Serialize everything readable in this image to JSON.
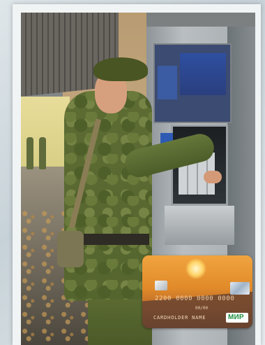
{
  "photo": {
    "description_icon": "soldier-at-atm-photo"
  },
  "card": {
    "number": "2200 0000 0000 0000",
    "expiry": "00/00",
    "holder": "CARDHOLDER NAME",
    "payment_system": "МИР",
    "colors": {
      "background_top": "#f0a43f",
      "background_bottom": "#5a3a2a",
      "logo_text": "#1f8e3f"
    }
  }
}
